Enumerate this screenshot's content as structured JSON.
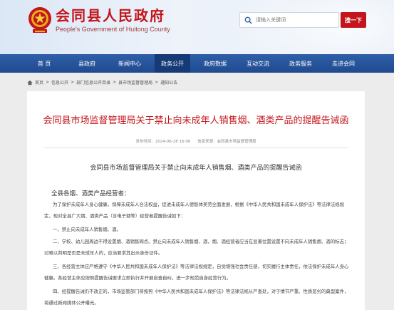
{
  "header": {
    "site_title": "会同县人民政府",
    "site_subtitle": "People's Government of Huitong County",
    "search_placeholder": "请输入关键词",
    "search_button": "搜一下",
    "accent": "#c3151b"
  },
  "nav": {
    "items": [
      "首 页",
      "县政府",
      "新闻中心",
      "政务公开",
      "政府数据",
      "互动交流",
      "政务服务",
      "走进会同"
    ],
    "active": "政务公开"
  },
  "breadcrumb": {
    "items": [
      "首页",
      "信息公开",
      "部门信息公开目录",
      "县市场监督管理局",
      "通知公告"
    ]
  },
  "article": {
    "title": "会同县市场监督管理局关于禁止向未成年人销售烟、酒类产品的提醒告诫函",
    "publish_time": "发布时间：2024-06-28 16:06",
    "source": "信息来源：会同县市场监督管理局",
    "subtitle": "会同县市场监督管理局关于禁止向未成年人销售烟、酒类产品的提醒告诫函",
    "salutation": "全县各烟、酒类产品经营者：",
    "paragraphs": [
      "为了保护未成年人身心健康，保障未成年人合法权益，促进未成年人德智体美劳全面发展，根据《中华人民共和国未成年人保护法》等法律法规规定，现对全县广大烟、酒类产品（含电子烟等）经营者提醒告诫如下：",
      "一、禁止向未成年人销售烟、酒。",
      "二、学校、幼儿园周边不得设置烟、酒销售网点。禁止向未成年人销售烟、酒，烟、酒经营者应当在显著位置设置不向未成年人销售烟、酒的标志；对难以判明是否是未成年人的，应当要求其出示身份证件。",
      "三、各经营主体应严格遵守《中华人民共和国未成年人保护法》等法律法规规定，自觉增强社会责任感，切实履行主体责任，依法保护未成年人身心健康。各经营主体应按照提醒告诫要求立即执行并开展自查自纠，进一步规范自身经营行为。",
      "四、经提醒告诫仍不改正的，市场监管部门将按照《中华人民共和国未成年人保护法》等法律法规从严查处，对于情节严重、性质恶劣的典型案件，将通过新闻媒体公开曝光。"
    ]
  }
}
